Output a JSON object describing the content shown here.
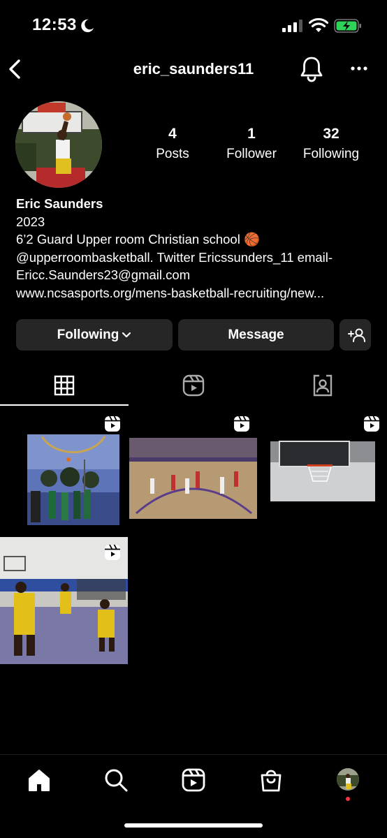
{
  "status": {
    "time": "12:53"
  },
  "header": {
    "username": "eric_saunders11"
  },
  "stats": [
    {
      "value": "4",
      "label": "Posts"
    },
    {
      "value": "1",
      "label": "Follower"
    },
    {
      "value": "32",
      "label": "Following"
    }
  ],
  "bio": {
    "name": "Eric Saunders",
    "line1": "2023",
    "line2": "6’2 Guard Upper room Christian school 🏀",
    "line3": "@upperroombasketball.  Twitter Ericssunders_11 email-",
    "line4": "Ericc.Saunders23@gmail.com",
    "link": "www.ncsasports.org/mens-basketball-recruiting/new..."
  },
  "actions": {
    "following_label": "Following",
    "message_label": "Message"
  },
  "tabs": [
    "grid-icon",
    "reels-icon",
    "tagged-icon"
  ],
  "colors": {
    "background": "#000000",
    "button_bg": "#262626",
    "battery_green": "#30d158",
    "notification_dot": "#ff3040"
  },
  "bottom_nav": [
    "home-icon",
    "search-icon",
    "reels-icon",
    "shop-icon",
    "profile-avatar"
  ]
}
